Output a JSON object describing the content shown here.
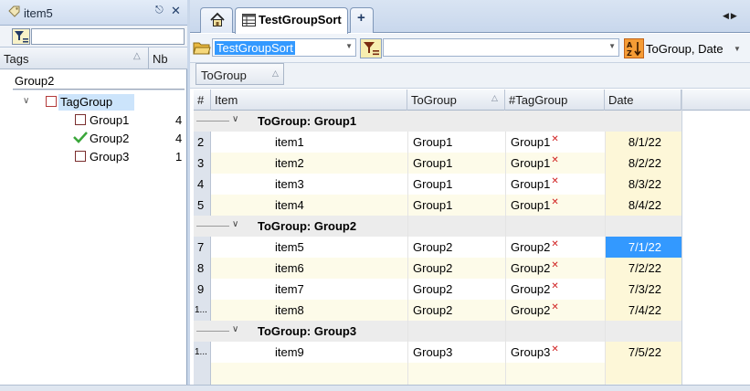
{
  "left_panel": {
    "title": "item5",
    "columns": {
      "tags": "Tags",
      "nb": "Nb"
    },
    "group_label": "Group2",
    "tree": {
      "root": "TagGroup",
      "children": [
        {
          "label": "Group1",
          "count": "4",
          "state": "unchecked"
        },
        {
          "label": "Group2",
          "count": "4",
          "state": "checked"
        },
        {
          "label": "Group3",
          "count": "1",
          "state": "unchecked"
        }
      ]
    }
  },
  "tabs": {
    "home_icon": "home-icon",
    "main": "TestGroupSort",
    "add": "+"
  },
  "toolbar": {
    "sort_name": "TestGroupSort",
    "sort_text": "ToGroup, Date"
  },
  "group_chip": "ToGroup",
  "grid": {
    "headers": {
      "num": "#",
      "item": "Item",
      "togroup": "ToGroup",
      "taggroup": "#TagGroup",
      "date": "Date"
    },
    "groups": [
      {
        "label": "ToGroup: Group1",
        "rows": [
          {
            "num": "2",
            "item": "item1",
            "togroup": "Group1",
            "taggroup": "Group1",
            "date": "8/1/22"
          },
          {
            "num": "3",
            "item": "item2",
            "togroup": "Group1",
            "taggroup": "Group1",
            "date": "8/2/22"
          },
          {
            "num": "4",
            "item": "item3",
            "togroup": "Group1",
            "taggroup": "Group1",
            "date": "8/3/22"
          },
          {
            "num": "5",
            "item": "item4",
            "togroup": "Group1",
            "taggroup": "Group1",
            "date": "8/4/22"
          }
        ]
      },
      {
        "label": "ToGroup: Group2",
        "rows": [
          {
            "num": "7",
            "item": "item5",
            "togroup": "Group2",
            "taggroup": "Group2",
            "date": "7/1/22"
          },
          {
            "num": "8",
            "item": "item6",
            "togroup": "Group2",
            "taggroup": "Group2",
            "date": "7/2/22"
          },
          {
            "num": "9",
            "item": "item7",
            "togroup": "Group2",
            "taggroup": "Group2",
            "date": "7/3/22"
          },
          {
            "num": "1...",
            "item": "item8",
            "togroup": "Group2",
            "taggroup": "Group2",
            "date": "7/4/22"
          }
        ]
      },
      {
        "label": "ToGroup: Group3",
        "rows": [
          {
            "num": "1...",
            "item": "item9",
            "togroup": "Group3",
            "taggroup": "Group3",
            "date": "7/5/22"
          }
        ]
      }
    ]
  },
  "colors": {
    "selection": "#3399ff",
    "date_column": "#fdf7d8",
    "group_row": "#ececec",
    "check_green": "#3aa63a",
    "x_red": "#d02020"
  }
}
